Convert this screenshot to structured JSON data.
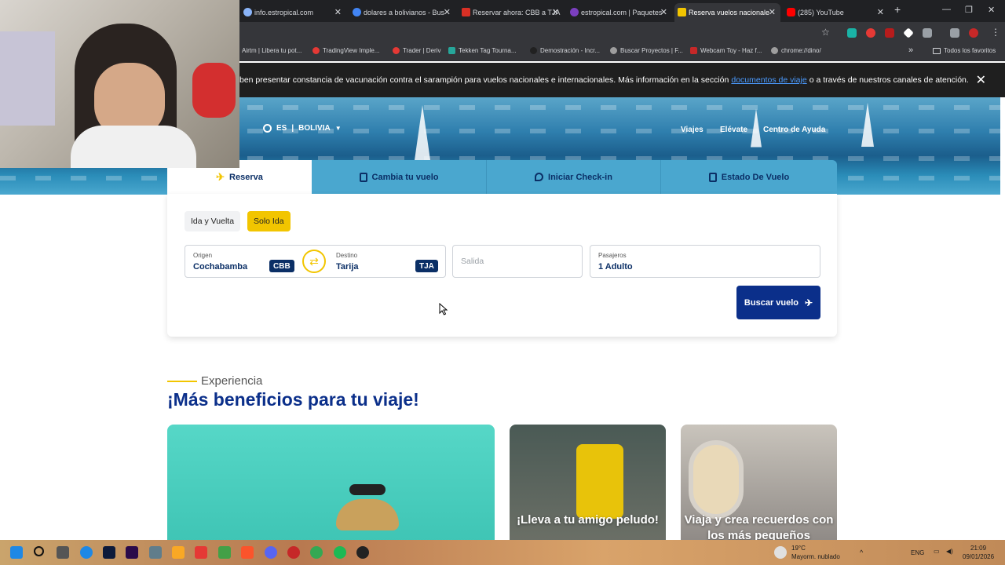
{
  "browser": {
    "tabs": [
      {
        "title": "info.estropical.com",
        "fav": "#8ab4f8"
      },
      {
        "title": "dolares a bolivianos - Bus",
        "fav": "#4285f4"
      },
      {
        "title": "Reservar ahora: CBB a TJA",
        "fav": "#d93025"
      },
      {
        "title": "estropical.com | Paquetes",
        "fav": "#7b3fbf"
      },
      {
        "title": "Reserva vuelos nacionale",
        "fav": "#f2c500"
      },
      {
        "title": "(285) YouTube",
        "fav": "#ff0000"
      }
    ],
    "new_tab": "+",
    "bookmarks": [
      {
        "label": "Airtm | Libera tu pot...",
        "color": "#1aa3ff"
      },
      {
        "label": "TradingView Imple...",
        "color": "#e53935"
      },
      {
        "label": "Trader | Deriv",
        "color": "#e53935"
      },
      {
        "label": "Tekken Tag Tourna...",
        "color": "#26a69a"
      },
      {
        "label": "Demostración - Incr...",
        "color": "#212121"
      },
      {
        "label": "Buscar Proyectos | F...",
        "color": "#9e9e9e"
      },
      {
        "label": "Webcam Toy - Haz f...",
        "color": "#c62828"
      },
      {
        "label": "chrome://dino/",
        "color": "#9e9e9e"
      }
    ],
    "bookmarks_more": "»",
    "all_bookmarks": "Todos los favoritos"
  },
  "notice": {
    "text_before": "ben presentar constancia de vacunación contra el sarampión para vuelos nacionales e internacionales. Más información en la sección",
    "link": "documentos de viaje",
    "text_after": "o a través de nuestros canales de atención."
  },
  "header": {
    "lang": "ES",
    "country": "BOLIVIA",
    "nav": [
      "Viajes",
      "Elévate",
      "Centro de Ayuda"
    ]
  },
  "booking_tabs": [
    {
      "label": "Reserva",
      "icon": "plane-icon"
    },
    {
      "label": "Cambia tu vuelo",
      "icon": "sign-icon"
    },
    {
      "label": "Iniciar Check-in",
      "icon": "location-icon"
    },
    {
      "label": "Estado De Vuelo",
      "icon": "tablet-icon"
    }
  ],
  "form": {
    "trip_round": "Ida y Vuelta",
    "trip_oneway": "Solo Ida",
    "origin_label": "Origen",
    "origin_value": "Cochabamba",
    "origin_code": "CBB",
    "dest_label": "Destino",
    "dest_value": "Tarija",
    "dest_code": "TJA",
    "departure_placeholder": "Salida",
    "pax_label": "Pasajeros",
    "pax_value": "1 Adulto",
    "search_button": "Buscar vuelo"
  },
  "experience": {
    "kicker": "Experiencia",
    "title": "¡Más beneficios para tu viaje!",
    "cards": [
      {
        "text": ""
      },
      {
        "text": "¡Lleva a tu amigo peludo!"
      },
      {
        "text": "Viaja y crea recuerdos con los más pequeños"
      }
    ]
  },
  "taskbar": {
    "weather_temp": "19°C",
    "weather_desc": "Mayorm. nublado",
    "lang": "ENG",
    "time": "21:09",
    "date": "09/01/2026"
  },
  "colors": {
    "brand_navy": "#0b2f8a",
    "brand_yellow": "#f2c500",
    "tab_blue": "#4aa7cf"
  }
}
